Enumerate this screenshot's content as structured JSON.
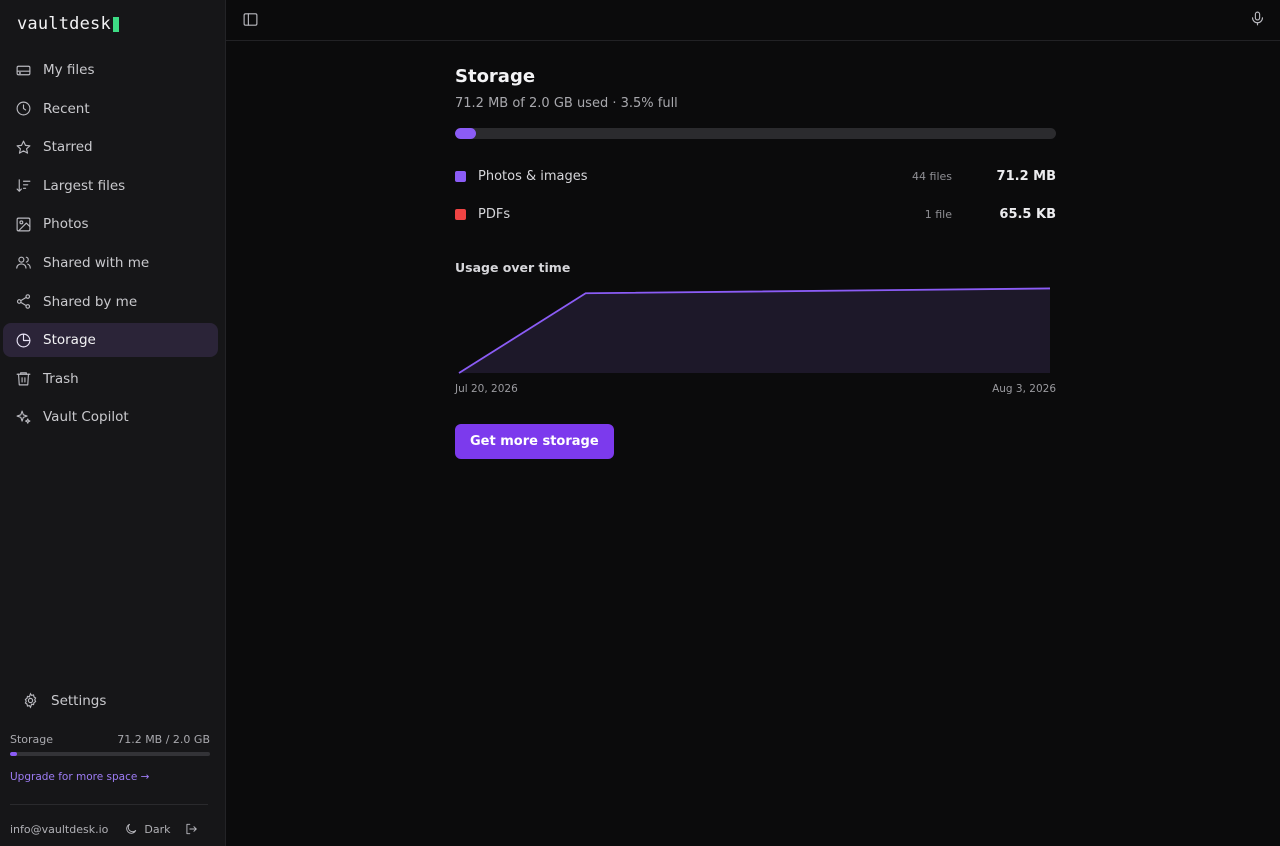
{
  "app": {
    "name": "vaultdesk"
  },
  "sidebar": {
    "items": [
      {
        "label": "My files",
        "icon": "drive-icon"
      },
      {
        "label": "Recent",
        "icon": "clock-icon"
      },
      {
        "label": "Starred",
        "icon": "star-icon"
      },
      {
        "label": "Largest files",
        "icon": "sort-desc-icon"
      },
      {
        "label": "Photos",
        "icon": "image-icon"
      },
      {
        "label": "Shared with me",
        "icon": "users-icon"
      },
      {
        "label": "Shared by me",
        "icon": "share-icon"
      },
      {
        "label": "Storage",
        "icon": "pie-chart-icon",
        "active": true
      },
      {
        "label": "Trash",
        "icon": "trash-icon"
      },
      {
        "label": "Vault Copilot",
        "icon": "sparkles-icon"
      }
    ],
    "settings_label": "Settings",
    "storage": {
      "label": "Storage",
      "usage_text": "71.2 MB / 2.0 GB",
      "used_fraction": 0.035
    },
    "upgrade_link": "Upgrade for more space →",
    "footer": {
      "email": "info@vaultdesk.io",
      "theme_label": "Dark"
    }
  },
  "main": {
    "title": "Storage",
    "subtitle": "71.2 MB of 2.0 GB used · 3.5% full",
    "used_fraction": 0.035,
    "categories": [
      {
        "name": "Photos & images",
        "count": "44 files",
        "size": "71.2 MB",
        "color": "#8b5cf6"
      },
      {
        "name": "PDFs",
        "count": "1 file",
        "size": "65.5 KB",
        "color": "#ef4444"
      }
    ],
    "usage_title": "Usage over time",
    "cta_label": "Get more storage"
  },
  "chart_data": {
    "type": "area",
    "x_start_label": "Jul 20, 2026",
    "x_end_label": "Aug 3, 2026",
    "x": [
      "Jul 20, 2026",
      "Jul 23, 2026",
      "Aug 3, 2026"
    ],
    "values_mb": [
      0,
      66,
      70
    ],
    "ylim": [
      0,
      71.2
    ],
    "color": "#8b5cf6"
  }
}
